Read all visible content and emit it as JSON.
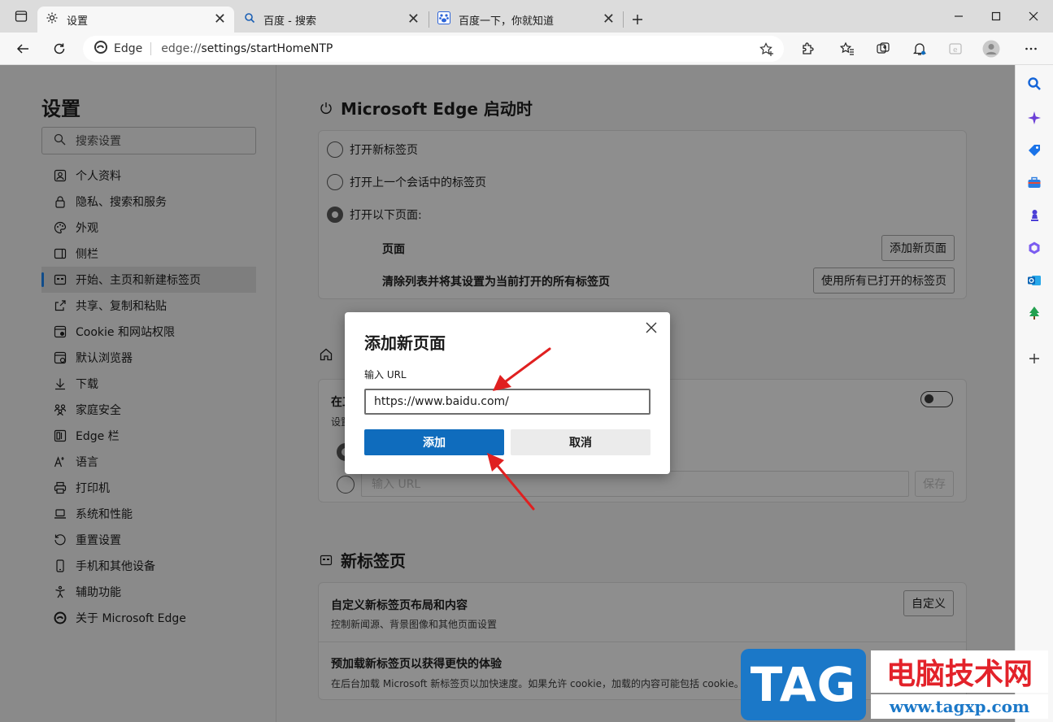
{
  "tabs": [
    {
      "title": "设置",
      "icon": "gear-icon",
      "active": true
    },
    {
      "title": "百度 - 搜索",
      "icon": "search-icon",
      "active": false
    },
    {
      "title": "百度一下，你就知道",
      "icon": "baidu-paw-icon",
      "active": false
    }
  ],
  "toolbar": {
    "brand": "Edge",
    "url_host": "edge://",
    "url_path": "settings/startHomeNTP"
  },
  "left_nav": {
    "title": "设置",
    "search_placeholder": "搜索设置",
    "items": [
      {
        "label": "个人资料",
        "icon": "profile-icon"
      },
      {
        "label": "隐私、搜索和服务",
        "icon": "lock-icon"
      },
      {
        "label": "外观",
        "icon": "palette-icon"
      },
      {
        "label": "侧栏",
        "icon": "sidebar-icon"
      },
      {
        "label": "开始、主页和新建标签页",
        "icon": "home-tab-icon",
        "selected": true
      },
      {
        "label": "共享、复制和粘贴",
        "icon": "share-icon"
      },
      {
        "label": "Cookie 和网站权限",
        "icon": "cookie-icon"
      },
      {
        "label": "默认浏览器",
        "icon": "browser-icon"
      },
      {
        "label": "下载",
        "icon": "download-icon"
      },
      {
        "label": "家庭安全",
        "icon": "family-icon"
      },
      {
        "label": "Edge 栏",
        "icon": "edge-bar-icon"
      },
      {
        "label": "语言",
        "icon": "language-icon"
      },
      {
        "label": "打印机",
        "icon": "printer-icon"
      },
      {
        "label": "系统和性能",
        "icon": "laptop-icon"
      },
      {
        "label": "重置设置",
        "icon": "reset-icon"
      },
      {
        "label": "手机和其他设备",
        "icon": "phone-icon"
      },
      {
        "label": "辅助功能",
        "icon": "accessibility-icon"
      },
      {
        "label": "关于 Microsoft Edge",
        "icon": "edge-logo-icon"
      }
    ]
  },
  "startup": {
    "title": "Microsoft Edge 启动时",
    "options": [
      "打开新标签页",
      "打开上一个会话中的标签页",
      "打开以下页面:"
    ],
    "pages_label": "页面",
    "add_page_button": "添加新页面",
    "clear_label": "清除列表并将其设置为当前打开的所有标签页",
    "use_all_button": "使用所有已打开的标签页"
  },
  "home": {
    "row_title_fragment": "在工",
    "row_sub_fragment": "设置",
    "url_placeholder": "输入 URL",
    "save_button": "保存"
  },
  "newtab": {
    "title": "新标签页",
    "customize_title": "自定义新标签页布局和内容",
    "customize_sub": "控制新闻源、背景图像和其他页面设置",
    "customize_button": "自定义",
    "preload_title": "预加载新标签页以获得更快的体验",
    "preload_sub": "在后台加载 Microsoft 新标签页以加快速度。如果允许 cookie，加载的内容可能包括 cookie。"
  },
  "dialog": {
    "title": "添加新页面",
    "label": "输入 URL",
    "value": "https://www.baidu.com/",
    "add_button": "添加",
    "cancel_button": "取消"
  },
  "watermark": {
    "tag": "TAG",
    "cn": "电脑技术网",
    "url": "www.tagxp.com"
  },
  "colors": {
    "accent": "#0f6cbd",
    "annotation_arrow": "#e02020",
    "watermark_blue": "#1b78c8",
    "watermark_red": "#e3222a"
  }
}
